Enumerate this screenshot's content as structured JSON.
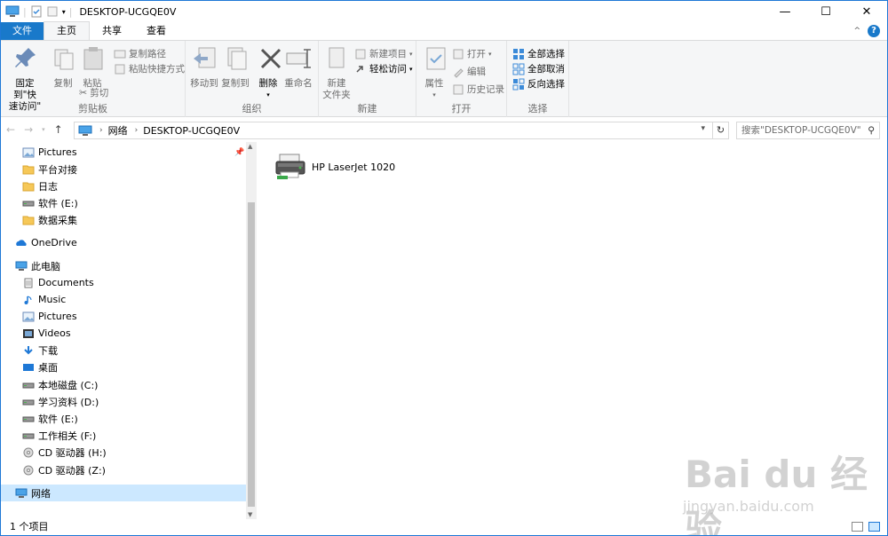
{
  "window": {
    "title": "DESKTOP-UCGQE0V",
    "minimize": "—",
    "maximize": "☐",
    "close": "✕"
  },
  "tabs": {
    "file": "文件",
    "home": "主页",
    "share": "共享",
    "view": "查看"
  },
  "ribbon": {
    "pin": "固定到\"快\n速访问\"",
    "copy": "复制",
    "paste": "粘贴",
    "copy_path": "复制路径",
    "paste_shortcut": "粘贴快捷方式",
    "cut": "剪切",
    "clipboard": "剪贴板",
    "move_to": "移动到",
    "copy_to": "复制到",
    "delete": "删除",
    "rename": "重命名",
    "organize": "组织",
    "new_folder": "新建\n文件夹",
    "new_item": "新建项目",
    "easy_access": "轻松访问",
    "new": "新建",
    "properties": "属性",
    "open": "打开",
    "edit": "编辑",
    "history": "历史记录",
    "open_group": "打开",
    "select_all": "全部选择",
    "select_none": "全部取消",
    "invert": "反向选择",
    "select_group": "选择"
  },
  "address": {
    "network": "网络",
    "computer": "DESKTOP-UCGQE0V",
    "search_placeholder": "搜索\"DESKTOP-UCGQE0V\""
  },
  "nav": {
    "items": [
      {
        "label": "Pictures",
        "icon": "pictures-icon"
      },
      {
        "label": "平台对接",
        "icon": "folder-icon"
      },
      {
        "label": "日志",
        "icon": "folder-icon"
      },
      {
        "label": "软件 (E:)",
        "icon": "drive-icon"
      },
      {
        "label": "数据采集",
        "icon": "folder-icon"
      },
      {
        "label": "OneDrive",
        "icon": "onedrive-icon"
      },
      {
        "label": "此电脑",
        "icon": "computer-icon"
      },
      {
        "label": "Documents",
        "icon": "documents-icon"
      },
      {
        "label": "Music",
        "icon": "music-icon"
      },
      {
        "label": "Pictures",
        "icon": "pictures-icon"
      },
      {
        "label": "Videos",
        "icon": "videos-icon"
      },
      {
        "label": "下载",
        "icon": "download-icon"
      },
      {
        "label": "桌面",
        "icon": "desktop-icon"
      },
      {
        "label": "本地磁盘 (C:)",
        "icon": "drive-icon"
      },
      {
        "label": "学习资料 (D:)",
        "icon": "drive-icon"
      },
      {
        "label": "软件 (E:)",
        "icon": "drive-icon"
      },
      {
        "label": "工作相关 (F:)",
        "icon": "drive-icon"
      },
      {
        "label": "CD 驱动器 (H:)",
        "icon": "cd-icon"
      },
      {
        "label": "CD 驱动器 (Z:)",
        "icon": "cd-icon"
      },
      {
        "label": "网络",
        "icon": "network-icon"
      }
    ]
  },
  "content": {
    "printer_name": "HP LaserJet 1020"
  },
  "status": {
    "count": "1 个项目"
  },
  "watermark": {
    "main": "Bai du 经验",
    "sub": "jingyan.baidu.com"
  }
}
